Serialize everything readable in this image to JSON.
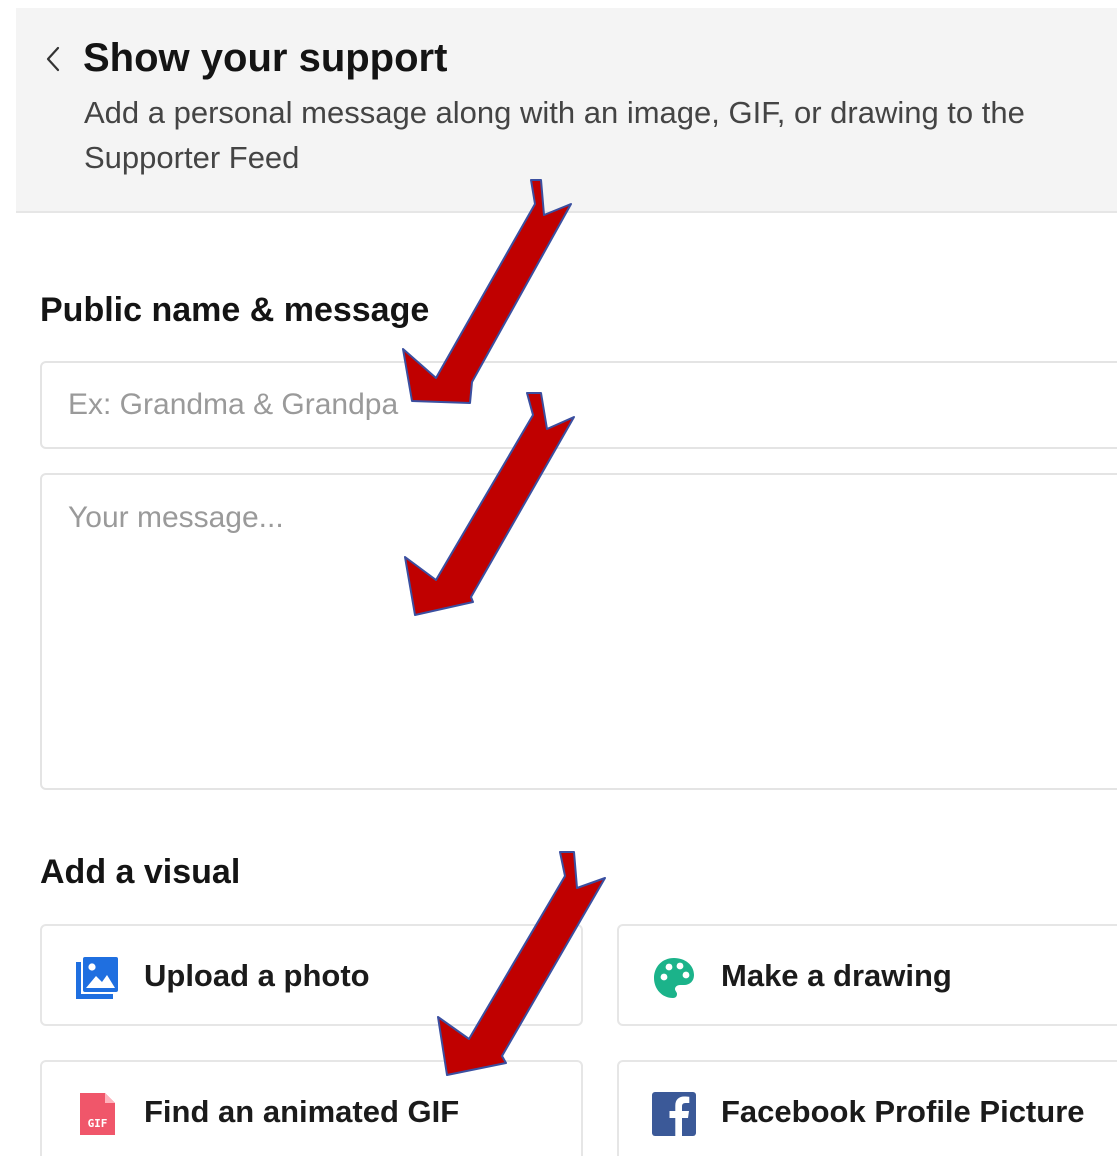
{
  "header": {
    "title": "Show your support",
    "subtitle": "Add a personal message along with an image, GIF, or drawing to the Supporter Feed"
  },
  "public_section": {
    "heading": "Public name & message",
    "name_placeholder": "Ex: Grandma & Grandpa",
    "name_value": "",
    "message_placeholder": "Your message...",
    "message_value": ""
  },
  "visual_section": {
    "heading": "Add a visual",
    "options": [
      {
        "label": "Upload a photo",
        "icon": "image-icon",
        "color": "#1f6fe0"
      },
      {
        "label": "Make a drawing",
        "icon": "palette-icon",
        "color": "#1bb38a"
      },
      {
        "label": "Find an animated GIF",
        "icon": "gif-file-icon",
        "color": "#f0566a"
      },
      {
        "label": "Facebook Profile Picture",
        "icon": "facebook-icon",
        "color": "#3b5998"
      }
    ]
  },
  "annotations": {
    "arrow_color": "#c00000",
    "arrow_outline_color": "#3a4fa0"
  }
}
